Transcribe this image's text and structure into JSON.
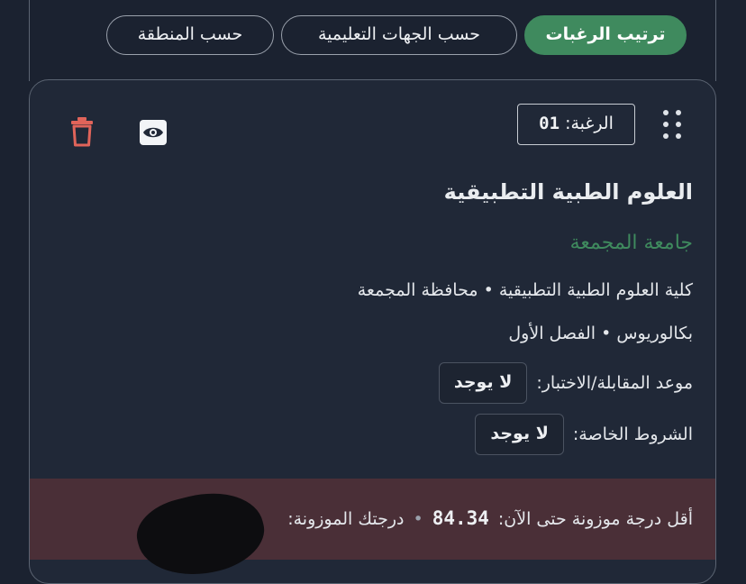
{
  "tabs": [
    {
      "label": "ترتيب الرغبات",
      "active": true
    },
    {
      "label": "حسب الجهات التعليمية",
      "active": false
    },
    {
      "label": "حسب المنطقة",
      "active": false
    }
  ],
  "card": {
    "preference_label": "الرغبة:",
    "preference_number": "01",
    "program_title": "العلوم الطبية التطبيقية",
    "university": "جامعة المجمعة",
    "college_line": "كلية العلوم الطبية التطبيقية • محافظة المجمعة",
    "degree_line": "بكالوريوس • الفصل الأول",
    "interview": {
      "label": "موعد المقابلة/الاختبار:",
      "value": "لا يوجد"
    },
    "conditions": {
      "label": "الشروط الخاصة:",
      "value": "لا يوجد"
    },
    "score": {
      "min_label": "أقل درجة موزونة حتى الآن:",
      "min_value": "84.34",
      "your_label": "درجتك الموزونة:"
    }
  },
  "icons": {
    "drag": "drag-handle-icon",
    "view": "eye-icon",
    "delete": "trash-icon"
  },
  "colors": {
    "accent_green": "#3f8a5e",
    "delete_red": "#e0645a",
    "score_band": "#4a2f37"
  }
}
